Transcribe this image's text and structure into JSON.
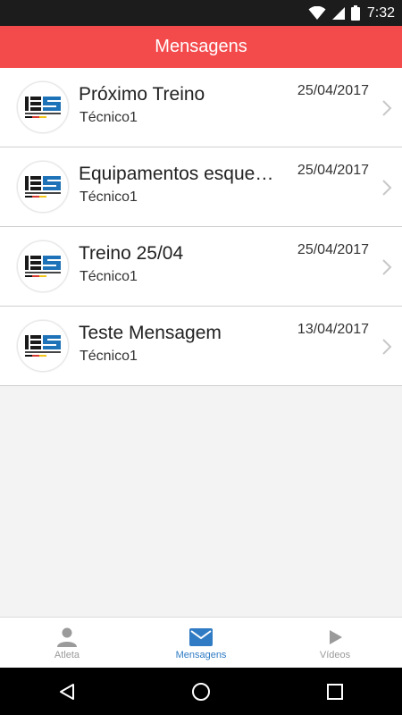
{
  "status_bar": {
    "time": "7:32",
    "icons": [
      "wifi-icon",
      "signal-icon",
      "battery-icon"
    ]
  },
  "header": {
    "title": "Mensagens",
    "color": "#f34a4c"
  },
  "logo": {
    "letters": "IES",
    "tagline": "INTERNATIONAL EVALUATION SYSTEM"
  },
  "messages": [
    {
      "title": "Próximo Treino",
      "sender": "Técnico1",
      "date": "25/04/2017"
    },
    {
      "title": "Equipamentos esquecidos",
      "sender": "Técnico1",
      "date": "25/04/2017"
    },
    {
      "title": "Treino 25/04",
      "sender": "Técnico1",
      "date": "25/04/2017"
    },
    {
      "title": "Teste Mensagem",
      "sender": "Técnico1",
      "date": "13/04/2017"
    }
  ],
  "tabs": [
    {
      "label": "Atleta",
      "icon": "person-icon",
      "active": false
    },
    {
      "label": "Mensagens",
      "icon": "envelope-icon",
      "active": true
    },
    {
      "label": "Vídeos",
      "icon": "play-icon",
      "active": false
    }
  ],
  "colors": {
    "active_tab": "#2f7bc4",
    "inactive_tab": "#9a9a9a"
  },
  "nav": [
    "back-icon",
    "home-icon",
    "recents-icon"
  ]
}
